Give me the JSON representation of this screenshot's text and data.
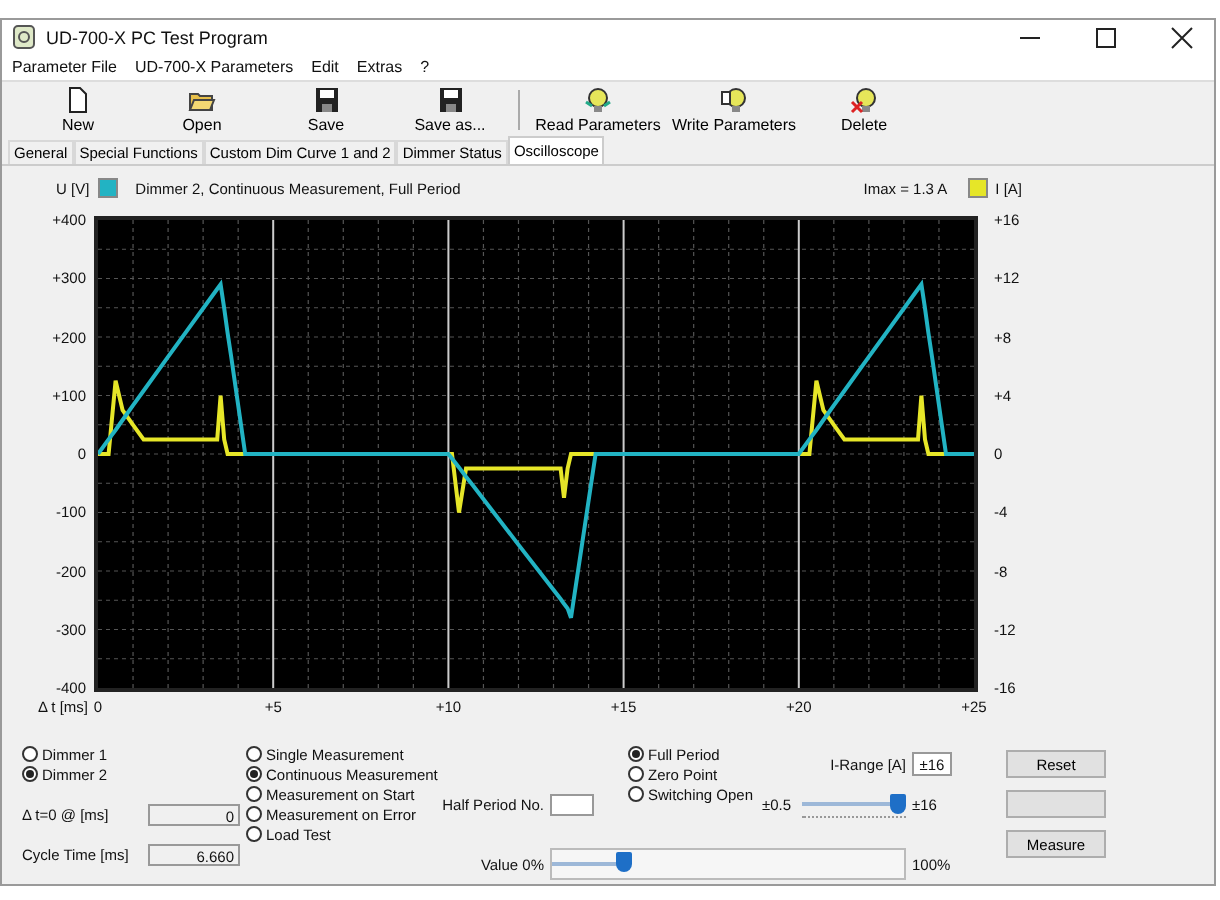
{
  "window": {
    "title": "UD-700-X PC Test Program"
  },
  "menu": [
    "Parameter File",
    "UD-700-X Parameters",
    "Edit",
    "Extras",
    "?"
  ],
  "toolbar": [
    {
      "label": "New",
      "kind": "new"
    },
    {
      "label": "Open",
      "kind": "open"
    },
    {
      "label": "Save",
      "kind": "save"
    },
    {
      "label": "Save as...",
      "kind": "save"
    },
    {
      "label": "Read Parameters",
      "kind": "read"
    },
    {
      "label": "Write Parameters",
      "kind": "write"
    },
    {
      "label": "Delete",
      "kind": "delete"
    }
  ],
  "tabs": [
    {
      "label": "General",
      "selected": false
    },
    {
      "label": "Special Functions",
      "selected": false
    },
    {
      "label": "Custom Dim Curve 1 and 2",
      "selected": false
    },
    {
      "label": "Dimmer Status",
      "selected": false
    },
    {
      "label": "Oscilloscope",
      "selected": true
    }
  ],
  "scope": {
    "chart_data": {
      "type": "line",
      "grid": true,
      "xlabel": "Δ t [ms]",
      "xlim": [
        0,
        25
      ],
      "ylim": [
        -400,
        400
      ],
      "y2lim": [
        -16,
        16
      ],
      "xticks": [
        {
          "value": 0,
          "label": "0"
        },
        {
          "value": 5,
          "label": "+5"
        },
        {
          "value": 10,
          "label": "+10"
        },
        {
          "value": 15,
          "label": "+15"
        },
        {
          "value": 20,
          "label": "+20"
        },
        {
          "value": 25,
          "label": "+25"
        }
      ],
      "yticks": [
        {
          "value": 400,
          "label": "+400"
        },
        {
          "value": 300,
          "label": "+300"
        },
        {
          "value": 200,
          "label": "+200"
        },
        {
          "value": 100,
          "label": "+100"
        },
        {
          "value": 0,
          "label": "0"
        },
        {
          "value": -100,
          "label": "-100"
        },
        {
          "value": -200,
          "label": "-200"
        },
        {
          "value": -300,
          "label": "-300"
        },
        {
          "value": -400,
          "label": "-400"
        }
      ],
      "y2ticks": [
        {
          "value": 16,
          "label": "+16"
        },
        {
          "value": 12,
          "label": "+12"
        },
        {
          "value": 8,
          "label": "+8"
        },
        {
          "value": 4,
          "label": "+4"
        },
        {
          "value": 0,
          "label": "0"
        },
        {
          "value": -4,
          "label": "-4"
        },
        {
          "value": -8,
          "label": "-8"
        },
        {
          "value": -12,
          "label": "-12"
        },
        {
          "value": -16,
          "label": "-16"
        }
      ],
      "x": [
        0,
        0.3,
        0.5,
        0.7,
        1,
        1.3,
        2,
        3.4,
        3.5,
        3.6,
        3.7,
        3.8,
        4.2,
        10,
        10.1,
        10.3,
        10.5,
        10.7,
        12,
        13.2,
        13.3,
        13.4,
        13.5,
        14.2,
        20,
        20.3,
        20.5,
        20.7,
        21,
        21.3,
        22,
        23.4,
        23.5,
        23.6,
        23.7,
        23.8,
        24.2,
        25
      ],
      "series": [
        {
          "name": "U [V]",
          "color": "#22b3c3",
          "values": [
            0,
            25,
            41,
            58,
            83,
            108,
            166,
            282,
            290,
            249,
            207,
            166,
            0,
            0,
            -8,
            -23,
            -39,
            -54,
            -155,
            -248,
            -256,
            -264,
            -280,
            0,
            0,
            25,
            41,
            58,
            83,
            108,
            166,
            282,
            290,
            249,
            207,
            166,
            0,
            0
          ]
        },
        {
          "name": "I [A]",
          "color": "#e6e628",
          "axis": "y2",
          "values": [
            0,
            0,
            5,
            3,
            2,
            1,
            1,
            1,
            4,
            1,
            0,
            0,
            0,
            0,
            0,
            -4,
            -1,
            -1,
            -1,
            -1,
            -3,
            -1,
            0,
            0,
            0,
            0,
            5,
            3,
            2,
            1,
            1,
            1,
            4,
            1,
            0,
            0,
            0,
            0
          ]
        }
      ]
    },
    "caption": "Dimmer 2, Continuous Measurement, Full Period",
    "imax": "Imax = 1.3 A"
  },
  "dimmers": [
    {
      "label": "Dimmer 1",
      "selected": false
    },
    {
      "label": "Dimmer 2",
      "selected": true
    }
  ],
  "delay": {
    "label": "Δ t=0 @ [ms]",
    "value": "0"
  },
  "cycle": {
    "label": "Cycle Time [ms]",
    "value": "6.660"
  },
  "modes": [
    {
      "label": "Single Measurement",
      "selected": false
    },
    {
      "label": "Continuous Measurement",
      "selected": true
    },
    {
      "label": "Measurement on Start",
      "selected": false
    },
    {
      "label": "Measurement on Error",
      "selected": false
    },
    {
      "label": "Load Test",
      "selected": false
    }
  ],
  "half_period": {
    "label": "Half Period No."
  },
  "value_slider": {
    "label": "Value 0%",
    "end": "100%",
    "level": 0.19
  },
  "periods": [
    {
      "label": "Full Period",
      "selected": true
    },
    {
      "label": "Zero Point",
      "selected": false
    },
    {
      "label": "Switching Open",
      "selected": false
    }
  ],
  "i_range": {
    "label": "I-Range [A]",
    "value": "±16",
    "min": "±0.5",
    "max": "±16",
    "level": 1.0
  },
  "buttons": [
    {
      "kind": "text",
      "label": "Reset"
    },
    {
      "kind": "blank"
    },
    {
      "kind": "text",
      "label": "Measure"
    }
  ]
}
